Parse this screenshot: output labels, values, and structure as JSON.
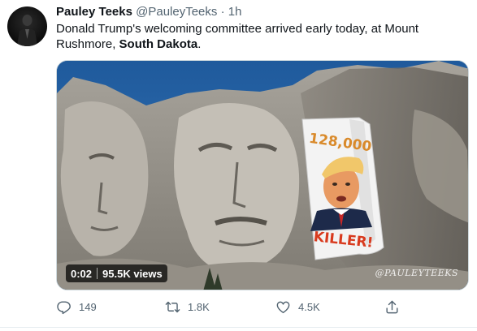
{
  "tweet": {
    "author_name": "Pauley Teeks",
    "author_handle": "@PauleyTeeks",
    "separator": "·",
    "time": "1h",
    "text_before": "Donald Trump's welcoming committee arrived early today, at Mount Rushmore, ",
    "text_bold": "South Dakota",
    "text_after": "."
  },
  "media": {
    "type": "video",
    "duration": "0:02",
    "views": "95.5K views",
    "banner_top": "128,000",
    "banner_bottom": "KILLER!",
    "watermark": "@PAULEYTEEKS"
  },
  "actions": {
    "reply_count": "149",
    "retweet_count": "1.8K",
    "like_count": "4.5K",
    "icons": [
      "reply-icon",
      "retweet-icon",
      "like-icon",
      "share-icon"
    ]
  },
  "colors": {
    "text_primary": "#0f1419",
    "text_secondary": "#536471",
    "sky": "#2b67a8",
    "banner_red": "#d83a1e"
  }
}
